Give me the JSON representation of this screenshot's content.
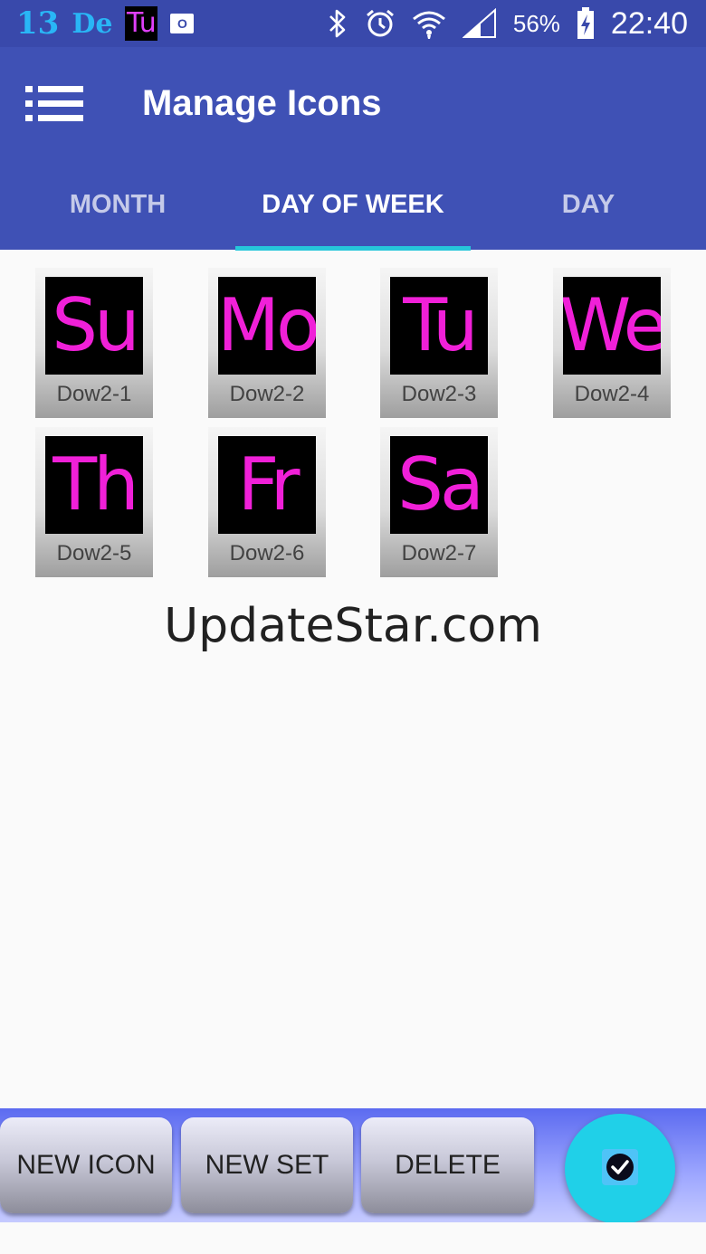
{
  "status_bar": {
    "notifications": {
      "date_num": "13",
      "day_abbr": "De",
      "tu_icon": "Tu",
      "outlook_icon": "O"
    },
    "battery_percent": "56%",
    "time": "22:40",
    "icons": [
      "bluetooth-icon",
      "alarm-icon",
      "wifi-icon",
      "signal-icon",
      "battery-charging-icon"
    ]
  },
  "app_bar": {
    "title": "Manage Icons",
    "menu_icon": "list-menu-icon"
  },
  "tabs": [
    {
      "label": "MONTH",
      "active": false
    },
    {
      "label": "DAY OF WEEK",
      "active": true
    },
    {
      "label": "DAY",
      "active": false
    }
  ],
  "icons": [
    {
      "glyph": "Su",
      "label": "Dow2-1"
    },
    {
      "glyph": "Mo",
      "label": "Dow2-2"
    },
    {
      "glyph": "Tu",
      "label": "Dow2-3"
    },
    {
      "glyph": "We",
      "label": "Dow2-4"
    },
    {
      "glyph": "Th",
      "label": "Dow2-5"
    },
    {
      "glyph": "Fr",
      "label": "Dow2-6"
    },
    {
      "glyph": "Sa",
      "label": "Dow2-7"
    }
  ],
  "watermark": "UpdateStar.com",
  "bottom_bar": {
    "new_icon": "NEW ICON",
    "new_set": "NEW SET",
    "delete": "DELETE",
    "fab_icon": "check-circle-icon"
  },
  "colors": {
    "primary": "#3f51b5",
    "status_bar": "#3949ab",
    "accent": "#26c6da",
    "glyph": "#f020d8"
  }
}
